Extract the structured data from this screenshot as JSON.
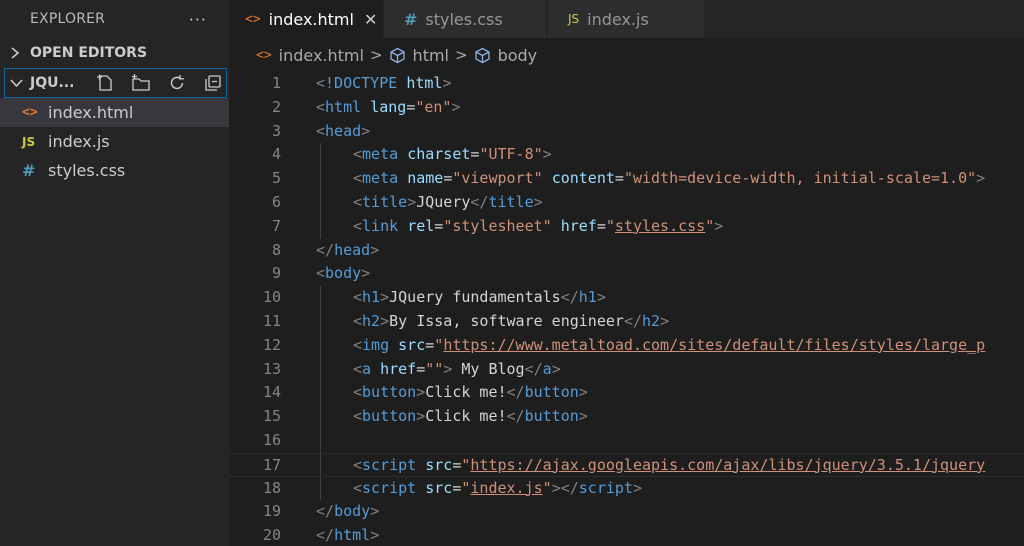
{
  "sidebar": {
    "title": "EXPLORER",
    "more": "···",
    "open_editors": "OPEN EDITORS",
    "workspace": "JQU...",
    "files": [
      {
        "name": "index.html",
        "icon": "html-file-icon",
        "glyph": "<>"
      },
      {
        "name": "index.js",
        "icon": "js-file-icon",
        "glyph": "JS"
      },
      {
        "name": "styles.css",
        "icon": "css-file-icon",
        "glyph": "#"
      }
    ]
  },
  "tabs": [
    {
      "label": "index.html",
      "glyph": "<>",
      "active": true,
      "close": "✕"
    },
    {
      "label": "styles.css",
      "glyph": "#",
      "active": false
    },
    {
      "label": "index.js",
      "glyph": "JS",
      "active": false
    }
  ],
  "breadcrumb": {
    "file": "index.html",
    "items": [
      "html",
      "body"
    ],
    "sep": ">",
    "file_glyph": "<>"
  },
  "editor": {
    "lines": [
      {
        "num": "1",
        "indent": 0,
        "tokens": [
          [
            "b",
            "<"
          ],
          [
            "t",
            "!DOCTYPE"
          ],
          [
            "x",
            " "
          ],
          [
            "a",
            "html"
          ],
          [
            "b",
            ">"
          ]
        ]
      },
      {
        "num": "2",
        "indent": 0,
        "tokens": [
          [
            "b",
            "<"
          ],
          [
            "t",
            "html"
          ],
          [
            "x",
            " "
          ],
          [
            "a",
            "lang"
          ],
          [
            "x",
            "="
          ],
          [
            "s",
            "\"en\""
          ],
          [
            "b",
            ">"
          ]
        ]
      },
      {
        "num": "3",
        "indent": 0,
        "tokens": [
          [
            "b",
            "<"
          ],
          [
            "t",
            "head"
          ],
          [
            "b",
            ">"
          ]
        ]
      },
      {
        "num": "4",
        "indent": 1,
        "tokens": [
          [
            "b",
            "<"
          ],
          [
            "t",
            "meta"
          ],
          [
            "x",
            " "
          ],
          [
            "a",
            "charset"
          ],
          [
            "x",
            "="
          ],
          [
            "s",
            "\"UTF-8\""
          ],
          [
            "b",
            ">"
          ]
        ]
      },
      {
        "num": "5",
        "indent": 1,
        "tokens": [
          [
            "b",
            "<"
          ],
          [
            "t",
            "meta"
          ],
          [
            "x",
            " "
          ],
          [
            "a",
            "name"
          ],
          [
            "x",
            "="
          ],
          [
            "s",
            "\"viewport\""
          ],
          [
            "x",
            " "
          ],
          [
            "a",
            "content"
          ],
          [
            "x",
            "="
          ],
          [
            "s",
            "\"width=device-width, initial-scale=1.0\""
          ],
          [
            "b",
            ">"
          ]
        ]
      },
      {
        "num": "6",
        "indent": 1,
        "tokens": [
          [
            "b",
            "<"
          ],
          [
            "t",
            "title"
          ],
          [
            "b",
            ">"
          ],
          [
            "x",
            "JQuery"
          ],
          [
            "b",
            "</"
          ],
          [
            "t",
            "title"
          ],
          [
            "b",
            ">"
          ]
        ]
      },
      {
        "num": "7",
        "indent": 1,
        "tokens": [
          [
            "b",
            "<"
          ],
          [
            "t",
            "link"
          ],
          [
            "x",
            " "
          ],
          [
            "a",
            "rel"
          ],
          [
            "x",
            "="
          ],
          [
            "s",
            "\"stylesheet\""
          ],
          [
            "x",
            " "
          ],
          [
            "a",
            "href"
          ],
          [
            "x",
            "="
          ],
          [
            "s",
            "\""
          ],
          [
            "l",
            "styles.css"
          ],
          [
            "s",
            "\""
          ],
          [
            "b",
            ">"
          ]
        ]
      },
      {
        "num": "8",
        "indent": 0,
        "tokens": [
          [
            "b",
            "</"
          ],
          [
            "t",
            "head"
          ],
          [
            "b",
            ">"
          ]
        ]
      },
      {
        "num": "9",
        "indent": 0,
        "tokens": [
          [
            "b",
            "<"
          ],
          [
            "t",
            "body"
          ],
          [
            "b",
            ">"
          ]
        ]
      },
      {
        "num": "10",
        "indent": 1,
        "tokens": [
          [
            "b",
            "<"
          ],
          [
            "t",
            "h1"
          ],
          [
            "b",
            ">"
          ],
          [
            "x",
            "JQuery fundamentals"
          ],
          [
            "b",
            "</"
          ],
          [
            "t",
            "h1"
          ],
          [
            "b",
            ">"
          ]
        ]
      },
      {
        "num": "11",
        "indent": 1,
        "tokens": [
          [
            "b",
            "<"
          ],
          [
            "t",
            "h2"
          ],
          [
            "b",
            ">"
          ],
          [
            "x",
            "By Issa, software engineer"
          ],
          [
            "b",
            "</"
          ],
          [
            "t",
            "h2"
          ],
          [
            "b",
            ">"
          ]
        ]
      },
      {
        "num": "12",
        "indent": 1,
        "tokens": [
          [
            "b",
            "<"
          ],
          [
            "t",
            "img"
          ],
          [
            "x",
            " "
          ],
          [
            "a",
            "src"
          ],
          [
            "x",
            "="
          ],
          [
            "s",
            "\""
          ],
          [
            "l",
            "https://www.metaltoad.com/sites/default/files/styles/large_p"
          ]
        ]
      },
      {
        "num": "13",
        "indent": 1,
        "tokens": [
          [
            "b",
            "<"
          ],
          [
            "t",
            "a"
          ],
          [
            "x",
            " "
          ],
          [
            "a",
            "href"
          ],
          [
            "x",
            "="
          ],
          [
            "s",
            "\"\""
          ],
          [
            "b",
            ">"
          ],
          [
            "x",
            " My Blog"
          ],
          [
            "b",
            "</"
          ],
          [
            "t",
            "a"
          ],
          [
            "b",
            ">"
          ]
        ]
      },
      {
        "num": "14",
        "indent": 1,
        "tokens": [
          [
            "b",
            "<"
          ],
          [
            "t",
            "button"
          ],
          [
            "b",
            ">"
          ],
          [
            "x",
            "Click me!"
          ],
          [
            "b",
            "</"
          ],
          [
            "t",
            "button"
          ],
          [
            "b",
            ">"
          ]
        ]
      },
      {
        "num": "15",
        "indent": 1,
        "tokens": [
          [
            "b",
            "<"
          ],
          [
            "t",
            "button"
          ],
          [
            "b",
            ">"
          ],
          [
            "x",
            "Click me!"
          ],
          [
            "b",
            "</"
          ],
          [
            "t",
            "button"
          ],
          [
            "b",
            ">"
          ]
        ]
      },
      {
        "num": "16",
        "indent": 1,
        "tokens": []
      },
      {
        "num": "17",
        "indent": 1,
        "current": true,
        "tokens": [
          [
            "b",
            "<"
          ],
          [
            "t",
            "script"
          ],
          [
            "x",
            " "
          ],
          [
            "a",
            "src"
          ],
          [
            "x",
            "="
          ],
          [
            "s",
            "\""
          ],
          [
            "l",
            "https://ajax.googleapis.com/ajax/libs/jquery/3.5.1/jquery"
          ]
        ]
      },
      {
        "num": "18",
        "indent": 1,
        "tokens": [
          [
            "b",
            "<"
          ],
          [
            "t",
            "script"
          ],
          [
            "x",
            " "
          ],
          [
            "a",
            "src"
          ],
          [
            "x",
            "="
          ],
          [
            "s",
            "\""
          ],
          [
            "l",
            "index.js"
          ],
          [
            "s",
            "\""
          ],
          [
            "b",
            "></"
          ],
          [
            "t",
            "script"
          ],
          [
            "b",
            ">"
          ]
        ]
      },
      {
        "num": "19",
        "indent": 0,
        "tokens": [
          [
            "b",
            "</"
          ],
          [
            "t",
            "body"
          ],
          [
            "b",
            ">"
          ]
        ]
      },
      {
        "num": "20",
        "indent": 0,
        "tokens": [
          [
            "b",
            "</"
          ],
          [
            "t",
            "html"
          ],
          [
            "b",
            ">"
          ]
        ]
      }
    ]
  },
  "colors": {
    "tag": "#569cd6",
    "attr": "#9cdcfe",
    "string": "#ce9178",
    "text": "#d4d4d4",
    "bracket": "#808080",
    "accent": "#0e639c"
  }
}
